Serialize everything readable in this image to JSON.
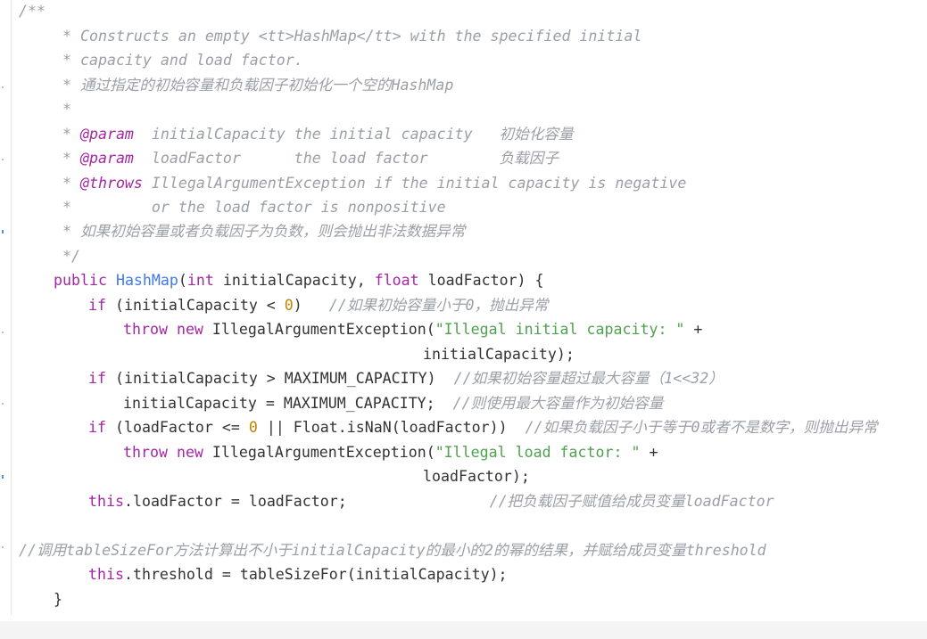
{
  "code": {
    "lines": [
      [
        {
          "t": "/**",
          "k": "c"
        }
      ],
      [
        {
          "t": "* Constructs an empty <tt>HashMap</tt> with the specified initial",
          "k": "c"
        }
      ],
      [
        {
          "t": "* capacity and load factor.",
          "k": "c"
        }
      ],
      [
        {
          "t": "* 通过指定的初始容量和负载因子初始化一个空的HashMap",
          "k": "c"
        }
      ],
      [
        {
          "t": "*",
          "k": "c"
        }
      ],
      [
        {
          "t": "* ",
          "k": "c"
        },
        {
          "t": "@param",
          "k": "tag"
        },
        {
          "t": "  initialCapacity the initial capacity   初始化容量",
          "k": "c"
        }
      ],
      [
        {
          "t": "* ",
          "k": "c"
        },
        {
          "t": "@param",
          "k": "tag"
        },
        {
          "t": "  loadFactor      the load factor        负载因子",
          "k": "c"
        }
      ],
      [
        {
          "t": "* ",
          "k": "c"
        },
        {
          "t": "@throws",
          "k": "tag"
        },
        {
          "t": " IllegalArgumentException if the initial capacity is negative",
          "k": "c"
        }
      ],
      [
        {
          "t": "*         or the load factor is nonpositive",
          "k": "c"
        }
      ],
      [
        {
          "t": "* 如果初始容量或者负载因子为负数，则会抛出非法数据异常",
          "k": "c"
        }
      ],
      [
        {
          "t": "*/",
          "k": "c"
        }
      ],
      [
        {
          "t": "public",
          "k": "kw"
        },
        {
          "t": " ",
          "k": "p"
        },
        {
          "t": "HashMap",
          "k": "fn"
        },
        {
          "t": "(",
          "k": "p"
        },
        {
          "t": "int",
          "k": "kw"
        },
        {
          "t": " initialCapacity, ",
          "k": "p"
        },
        {
          "t": "float",
          "k": "kw"
        },
        {
          "t": " loadFactor) {",
          "k": "p"
        }
      ],
      [
        {
          "t": "if",
          "k": "kw"
        },
        {
          "t": " (initialCapacity < ",
          "k": "p"
        },
        {
          "t": "0",
          "k": "num"
        },
        {
          "t": ")   ",
          "k": "p"
        },
        {
          "t": "//如果初始容量小于0，抛出异常",
          "k": "c"
        }
      ],
      [
        {
          "t": "throw",
          "k": "kw"
        },
        {
          "t": " ",
          "k": "p"
        },
        {
          "t": "new",
          "k": "kw"
        },
        {
          "t": " IllegalArgumentException(",
          "k": "p"
        },
        {
          "t": "\"Illegal initial capacity: \"",
          "k": "str"
        },
        {
          "t": " +",
          "k": "p"
        }
      ],
      [
        {
          "t": "initialCapacity);",
          "k": "p"
        }
      ],
      [
        {
          "t": "if",
          "k": "kw"
        },
        {
          "t": " (initialCapacity > MAXIMUM_CAPACITY)  ",
          "k": "p"
        },
        {
          "t": "//如果初始容量超过最大容量（1<<32）",
          "k": "c"
        }
      ],
      [
        {
          "t": "initialCapacity = MAXIMUM_CAPACITY;  ",
          "k": "p"
        },
        {
          "t": "//则使用最大容量作为初始容量",
          "k": "c"
        }
      ],
      [
        {
          "t": "if",
          "k": "kw"
        },
        {
          "t": " (loadFactor <= ",
          "k": "p"
        },
        {
          "t": "0",
          "k": "num"
        },
        {
          "t": " || Float.isNaN(loadFactor))  ",
          "k": "p"
        },
        {
          "t": "//如果负载因子小于等于0或者不是数字，则抛出异常",
          "k": "c"
        }
      ],
      [
        {
          "t": "throw",
          "k": "kw"
        },
        {
          "t": " ",
          "k": "p"
        },
        {
          "t": "new",
          "k": "kw"
        },
        {
          "t": " IllegalArgumentException(",
          "k": "p"
        },
        {
          "t": "\"Illegal load factor: \"",
          "k": "str"
        },
        {
          "t": " +",
          "k": "p"
        }
      ],
      [
        {
          "t": "loadFactor);",
          "k": "p"
        }
      ],
      [
        {
          "t": "this",
          "k": "kw"
        },
        {
          "t": ".loadFactor = loadFactor;                ",
          "k": "p"
        },
        {
          "t": "//把负载因子赋值给成员变量loadFactor",
          "k": "c"
        }
      ],
      [],
      [
        {
          "t": "//调用tableSizeFor方法计算出不小于initialCapacity的最小的2的幂的结果，并赋给成员变量threshold",
          "k": "c"
        }
      ],
      [
        {
          "t": "this",
          "k": "kw"
        },
        {
          "t": ".threshold = tableSizeFor(initialCapacity);",
          "k": "p"
        }
      ],
      [
        {
          "t": "}",
          "k": "p"
        }
      ]
    ]
  },
  "colors": {
    "comment": "#9aa0a6",
    "keyword": "#a626a4",
    "function": "#4078f2",
    "number": "#c18401",
    "string": "#50a14f",
    "plain": "#333333"
  }
}
